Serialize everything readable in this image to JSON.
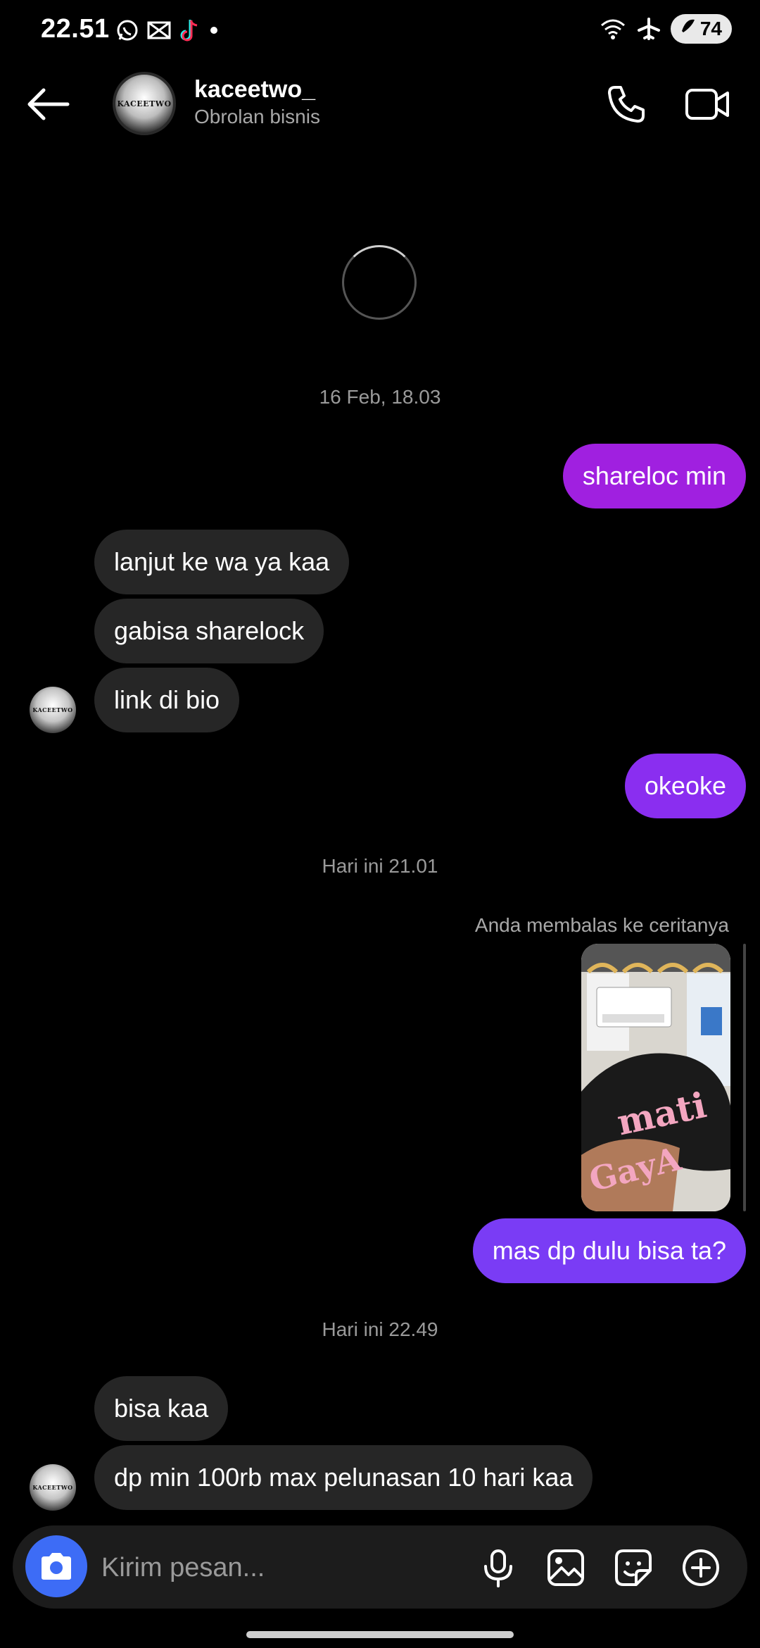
{
  "status_bar": {
    "time": "22.51",
    "battery": "74",
    "left_icons": [
      "whatsapp-icon",
      "capcut-icon",
      "tiktok-icon",
      "dot-icon"
    ],
    "right_icons": [
      "wifi-icon",
      "airplane-icon",
      "battery-icon"
    ]
  },
  "header": {
    "username": "kaceetwo_",
    "subtitle": "Obrolan bisnis",
    "avatar_text": "KACEETWO"
  },
  "conversation": {
    "timestamps": [
      "16 Feb, 18.03",
      "Hari ini 21.01",
      "Hari ini 22.49"
    ],
    "messages": [
      {
        "side": "out",
        "text": "shareloc min"
      },
      {
        "side": "in",
        "text": "lanjut ke wa ya kaa"
      },
      {
        "side": "in",
        "text": "gabisa sharelock"
      },
      {
        "side": "in",
        "text": "link di bio"
      },
      {
        "side": "out",
        "text": "okeoke"
      },
      {
        "side": "out",
        "text": "mas dp dulu bisa ta?"
      },
      {
        "side": "in",
        "text": "bisa kaa"
      },
      {
        "side": "in",
        "text": "dp min 100rb max pelunasan 10 hari kaa"
      }
    ],
    "story_reply_note": "Anda membalas ke ceritanya",
    "story_image": {
      "caption_line1": "mati",
      "caption_line2": "GayA"
    }
  },
  "composer": {
    "placeholder": "Kirim pesan..."
  },
  "colors": {
    "background": "#000000",
    "incoming_bubble": "#262626",
    "outgoing_purple": "#a020e0",
    "outgoing_violet": "#7a3cf5",
    "camera_button": "#3d6cf6"
  }
}
